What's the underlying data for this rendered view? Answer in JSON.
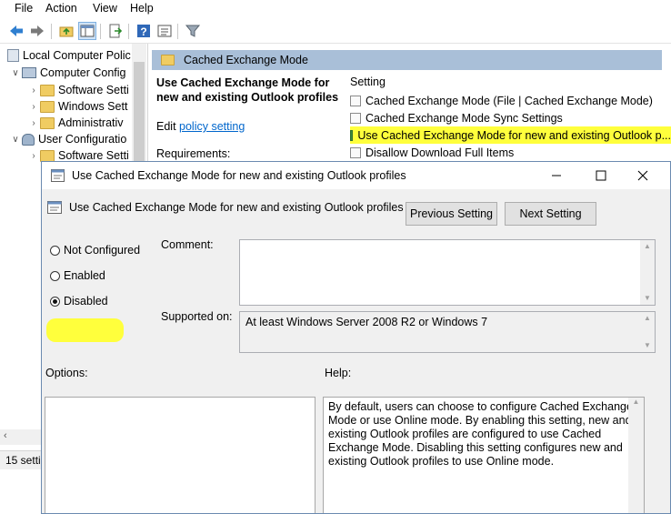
{
  "menu": [
    "File",
    "Action",
    "View",
    "Help"
  ],
  "tree": {
    "items": [
      {
        "label": "Local Computer Polic",
        "level": 0
      },
      {
        "label": "Computer Config",
        "level": 1
      },
      {
        "label": "Software Setti",
        "level": 2
      },
      {
        "label": "Windows Sett",
        "level": 2
      },
      {
        "label": "Administrativ",
        "level": 2
      },
      {
        "label": "User Configuratio",
        "level": 1
      },
      {
        "label": "Software Setti",
        "level": 2
      }
    ]
  },
  "right_pane": {
    "folder_header": "Cached Exchange Mode",
    "policy_title": "Use Cached Exchange Mode for new and existing Outlook profiles",
    "edit_prefix": "Edit",
    "edit_link": "policy setting",
    "requirements_label": "Requirements:",
    "setting_header": "Setting",
    "settings": [
      "Cached Exchange Mode (File | Cached Exchange Mode)",
      "Cached Exchange Mode Sync Settings",
      "Use Cached Exchange Mode for new and existing Outlook p...",
      "Disallow Download Full Items"
    ],
    "highlighted_index": 2
  },
  "status": {
    "count_text": "15 setti"
  },
  "dialog": {
    "title": "Use Cached Exchange Mode for new and existing Outlook profiles",
    "header_title": "Use Cached Exchange Mode for new and existing Outlook profiles",
    "prev_button": "Previous Setting",
    "next_button": "Next Setting",
    "radios": {
      "not_configured": "Not Configured",
      "enabled": "Enabled",
      "disabled": "Disabled",
      "selected": "disabled"
    },
    "comment_label": "Comment:",
    "comment_value": "",
    "supported_label": "Supported on:",
    "supported_value": "At least Windows Server 2008 R2 or Windows 7",
    "options_label": "Options:",
    "help_label": "Help:",
    "help_text": "By default, users can choose to configure Cached Exchange Mode or use Online mode. By enabling this setting, new and existing Outlook profiles are configured to use Cached Exchange Mode. Disabling this setting configures new and existing Outlook profiles to use Online mode."
  },
  "colors": {
    "highlight": "#ffff3c",
    "folder_header_bg": "#a9bfd8",
    "link": "#0066cc"
  },
  "icons": [
    "back-arrow-icon",
    "forward-arrow-icon",
    "up-folder-icon",
    "show-hide-tree-icon",
    "export-list-icon",
    "help-icon",
    "properties-icon",
    "filter-icon"
  ]
}
